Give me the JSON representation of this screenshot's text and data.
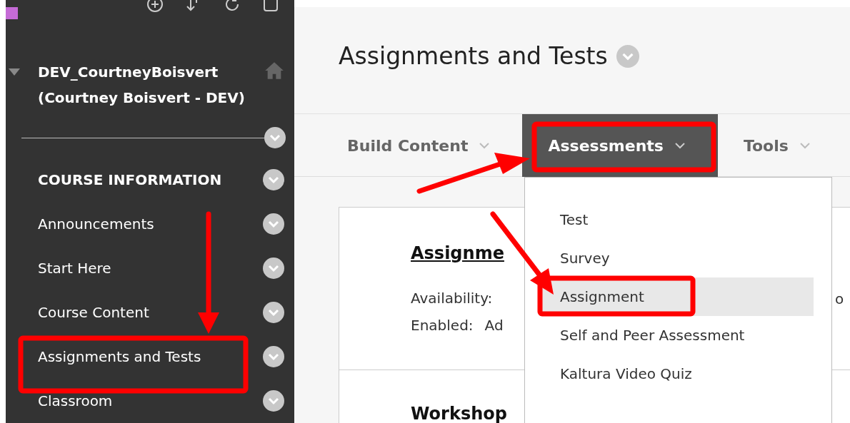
{
  "sidebar": {
    "course_title": "DEV_CourtneyBoisvert (Courtney Boisvert - DEV)",
    "expanded": true,
    "items": [
      {
        "label": "COURSE INFORMATION",
        "kind": "heading"
      },
      {
        "label": "Announcements",
        "kind": "link"
      },
      {
        "label": "Start Here",
        "kind": "link"
      },
      {
        "label": "Course Content",
        "kind": "link"
      },
      {
        "label": "Assignments and Tests",
        "kind": "link"
      },
      {
        "label": "Classroom",
        "kind": "link"
      }
    ]
  },
  "page": {
    "title": "Assignments and Tests",
    "action_bar": [
      {
        "label": "Build Content",
        "selected": false
      },
      {
        "label": "Assessments",
        "selected": true
      },
      {
        "label": "Tools",
        "selected": false
      }
    ],
    "dropdown": [
      {
        "label": "Test",
        "selected": false
      },
      {
        "label": "Survey",
        "selected": false
      },
      {
        "label": "Assignment",
        "selected": true
      },
      {
        "label": "Self and Peer Assessment",
        "selected": false
      },
      {
        "label": "Kaltura Video Quiz",
        "selected": false
      }
    ],
    "content_items": [
      {
        "title": "Assignme",
        "lines": [
          {
            "label": "Availability:"
          },
          {
            "label": "Enabled:",
            "value": "Ad"
          }
        ],
        "column_2": "o"
      },
      {
        "title": "Workshop"
      }
    ]
  }
}
